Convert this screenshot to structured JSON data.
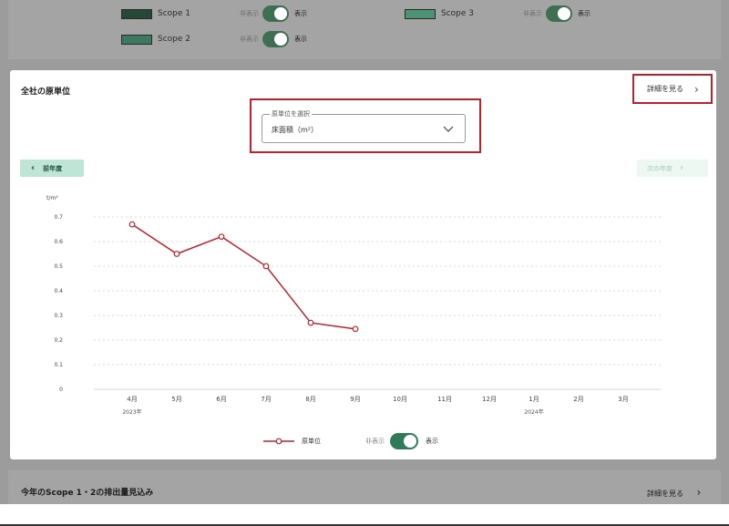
{
  "scope_legend": {
    "items": [
      {
        "label": "Scope 1",
        "color": "#254837",
        "hide": "非表示",
        "show": "表示"
      },
      {
        "label": "Scope 2",
        "color": "#3b7a60",
        "hide": "非表示",
        "show": "表示"
      },
      {
        "label": "Scope 3",
        "color": "#4d9274",
        "hide": "非表示",
        "show": "表示"
      }
    ]
  },
  "card": {
    "title": "全社の原単位",
    "detail_label": "詳細を見る",
    "select_label": "原単位を選択",
    "select_value": "床面積（m²）",
    "prev_label": "前年度",
    "next_label": "次の年度"
  },
  "chart_data": {
    "type": "line",
    "unit": "t/m²",
    "x": [
      "4月",
      "5月",
      "6月",
      "7月",
      "8月",
      "9月",
      "10月",
      "11月",
      "12月",
      "1月",
      "2月",
      "3月"
    ],
    "year_labels": [
      {
        "index": 0,
        "label": "2023年"
      },
      {
        "index": 9,
        "label": "2024年"
      }
    ],
    "series": [
      {
        "name": "原単位",
        "color": "#b8232d",
        "values": [
          0.67,
          0.55,
          0.62,
          0.5,
          0.27,
          0.245,
          null,
          null,
          null,
          null,
          null,
          null
        ]
      }
    ],
    "yticks": [
      "0",
      "0.1",
      "0.2",
      "0.3",
      "0.4",
      "0.5",
      "0.6",
      "0.7"
    ],
    "ylim": [
      0,
      0.7
    ],
    "grid": true,
    "legend_position": "bottom"
  },
  "legend": {
    "name": "原単位",
    "hide": "非表示",
    "show": "表示"
  },
  "bottom_card": {
    "title": "今年のScope 1・2の排出量見込み",
    "link_label": "詳細を見る"
  }
}
